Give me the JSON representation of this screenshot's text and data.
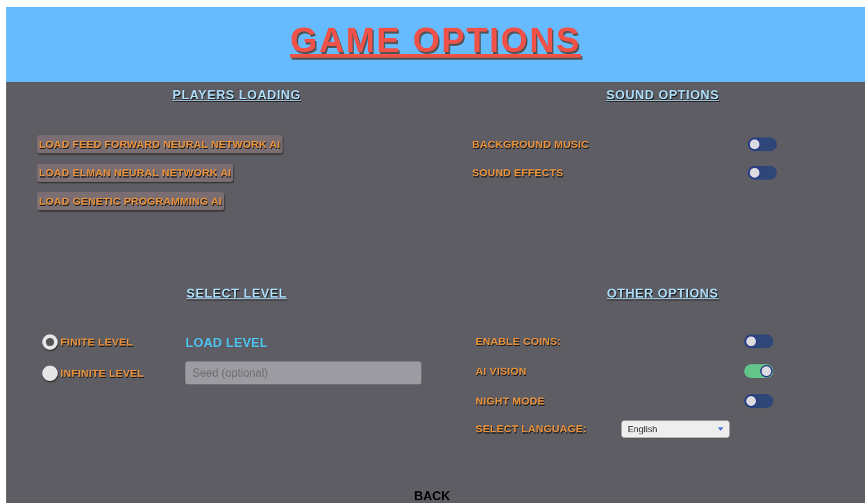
{
  "title": "GAME OPTIONS",
  "players_loading": {
    "heading": "PLAYERS LOADING",
    "buttons": [
      "LOAD FEED FORWARD NEURAL NETWORK AI",
      "LOAD ELMAN NEURAL NETWORK AI",
      "LOAD GENETIC PROGRAMMING AI"
    ]
  },
  "sound_options": {
    "heading": "SOUND OPTIONS",
    "toggles": [
      {
        "label": "BACKGROUND MUSIC",
        "on": false
      },
      {
        "label": "SOUND EFFECTS",
        "on": false
      }
    ]
  },
  "select_level": {
    "heading": "SELECT LEVEL",
    "radios": [
      {
        "label": "FINITE LEVEL",
        "selected": true
      },
      {
        "label": "INFINITE LEVEL",
        "selected": false
      }
    ],
    "load_level": "LOAD LEVEL",
    "seed": {
      "placeholder": "Seed (optional)"
    }
  },
  "other_options": {
    "heading": "OTHER OPTIONS",
    "toggles": [
      {
        "label": "ENABLE COINS:",
        "on": false
      },
      {
        "label": "AI VISION",
        "on": true
      },
      {
        "label": "NIGHT MODE",
        "on": false
      }
    ],
    "language": {
      "label": "SELECT LANGUAGE:",
      "value": "English"
    }
  },
  "back": "BACK"
}
